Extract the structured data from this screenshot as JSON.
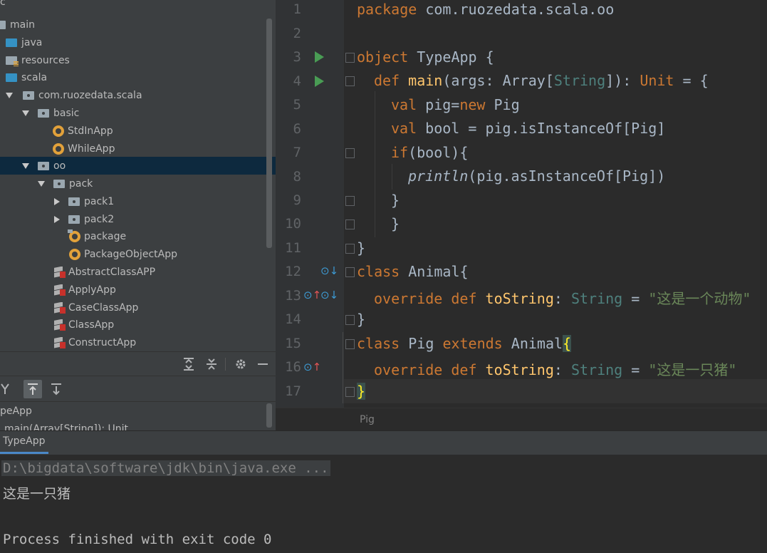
{
  "tree": {
    "top_partial": "c",
    "items": [
      {
        "label": "main",
        "icon": "folder-icon"
      },
      {
        "label": "java",
        "icon": "source-folder-icon"
      },
      {
        "label": "resources",
        "icon": "resources-folder-icon"
      },
      {
        "label": "scala",
        "icon": "source-folder-icon"
      },
      {
        "label": "com.ruozedata.scala",
        "icon": "package-icon"
      },
      {
        "label": "basic",
        "icon": "package-icon"
      },
      {
        "label": "StdInApp",
        "icon": "scala-object-icon"
      },
      {
        "label": "WhileApp",
        "icon": "scala-object-icon"
      },
      {
        "label": "oo",
        "icon": "package-icon",
        "selected": true
      },
      {
        "label": "pack",
        "icon": "package-icon"
      },
      {
        "label": "pack1",
        "icon": "package-icon"
      },
      {
        "label": "pack2",
        "icon": "package-icon"
      },
      {
        "label": "package",
        "icon": "package-object-icon"
      },
      {
        "label": "PackageObjectApp",
        "icon": "scala-object-icon"
      },
      {
        "label": "AbstractClassAPP",
        "icon": "scala-file-icon"
      },
      {
        "label": "ApplyApp",
        "icon": "scala-file-icon"
      },
      {
        "label": "CaseClassApp",
        "icon": "scala-file-icon"
      },
      {
        "label": "ClassApp",
        "icon": "scala-file-icon"
      },
      {
        "label": "ConstructApp",
        "icon": "scala-file-icon"
      }
    ]
  },
  "structure": {
    "toolbar_icons": [
      "expand-all-icon",
      "collapse-all-icon",
      "gear-icon",
      "minimize-icon"
    ],
    "sort_icons": [
      "inherited-icon",
      "sort-up-icon",
      "sort-down-icon"
    ],
    "items": [
      "peApp",
      "main(Array[String]): Unit"
    ]
  },
  "editor": {
    "line_numbers": [
      "1",
      "2",
      "3",
      "4",
      "5",
      "6",
      "7",
      "8",
      "9",
      "10",
      "11",
      "12",
      "13",
      "14",
      "15",
      "16",
      "17"
    ],
    "code": {
      "l1a": "package",
      "l1b": " com.ruozedata.scala.oo",
      "l3a": "object",
      "l3b": " TypeApp {",
      "l4a": "def",
      "l4b": "main",
      "l4c": "(args: Array[",
      "l4d": "String",
      "l4e": "]): ",
      "l4f": "Unit",
      "l4g": " = {",
      "l5a": "val",
      "l5b": " pig=",
      "l5c": "new",
      "l5d": " Pig",
      "l6a": "val",
      "l6b": " bool = pig.isInstanceOf[Pig]",
      "l7a": "if",
      "l7b": "(bool){",
      "l8a": "println",
      "l8b": "(pig.asInstanceOf[Pig])",
      "l9": "}",
      "l10": "}",
      "l11": "}",
      "l12a": "class",
      "l12b": " Animal{",
      "l13a": "override def",
      "l13b": "toString",
      "l13c": ": ",
      "l13d": "String",
      "l13e": " = ",
      "l13f": "\"这是一个动物\"",
      "l14": "}",
      "l15a": "class",
      "l15b": " Pig ",
      "l15c": "extends",
      "l15d": " Animal",
      "l15e": "{",
      "l16a": "override def",
      "l16b": "toString",
      "l16c": ": ",
      "l16d": "String",
      "l16e": " = ",
      "l16f": "\"这是一只猪\"",
      "l17": "}"
    },
    "breadcrumb": "Pig"
  },
  "run": {
    "tab_label": "TypeApp",
    "console": [
      "D:\\bigdata\\software\\jdk\\bin\\java.exe ...",
      "这是一只猪",
      "",
      "Process finished with exit code 0"
    ]
  },
  "colors": {
    "keyword": "#cc7832",
    "type": "#4e807d",
    "string": "#6a8759",
    "function": "#ffc66d",
    "run_gutter": "#499c54"
  }
}
